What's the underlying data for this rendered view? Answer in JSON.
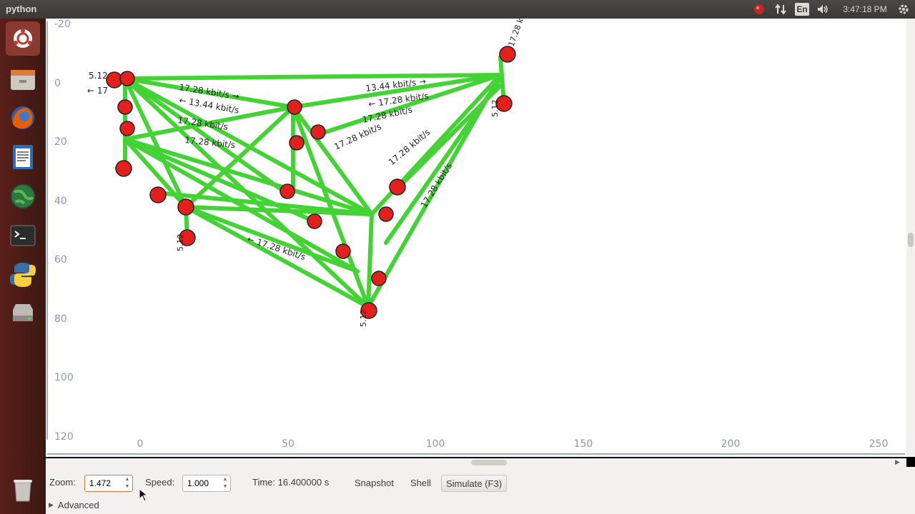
{
  "topbar": {
    "app_title": "python",
    "keyboard_layout": "En",
    "clock": "3:47:18 PM",
    "icons": [
      "record-icon",
      "network-icon",
      "keyboard-icon",
      "volume-icon",
      "gear-icon"
    ]
  },
  "launcher": {
    "items": [
      "dash-home-icon",
      "file-manager-icon",
      "firefox-icon",
      "text-editor-icon",
      "globe-icon",
      "terminal-icon",
      "python-icon",
      "drive-icon",
      "trash-icon"
    ]
  },
  "plot": {
    "y_ticks": [
      "-20",
      "0",
      "20",
      "40",
      "60",
      "80",
      "100",
      "120"
    ],
    "x_ticks": [
      "0",
      "50",
      "100",
      "150",
      "200",
      "250"
    ],
    "link_label_main": "17.28 kbit/s",
    "link_label_alt": "13.44 kbit/s",
    "link_label_small": "5.12",
    "node_color": "#e3201b",
    "link_color": "#3ad12a",
    "labels": [
      "17.28 kbit/s →",
      "13.44 kbit/s →",
      "← 17.28 kbit/s",
      "17.28 kbit/s",
      "← 13.44 kbit/s",
      "17.28 kbit/s",
      "← 17.28 kbit/s",
      "17.28 kbit/s",
      "17.28 kbit/s",
      "17.28 kbit/s",
      "5.12",
      "← 17",
      "17.28 kbit/s"
    ]
  },
  "toolbar": {
    "zoom_label": "Zoom:",
    "zoom_value": "1.472",
    "speed_label": "Speed:",
    "speed_value": "1.000",
    "time_text": "Time: 16.400000 s",
    "snapshot_label": "Snapshot",
    "shell_label": "Shell",
    "simulate_label": "Simulate (F3)",
    "advanced_label": "Advanced"
  }
}
